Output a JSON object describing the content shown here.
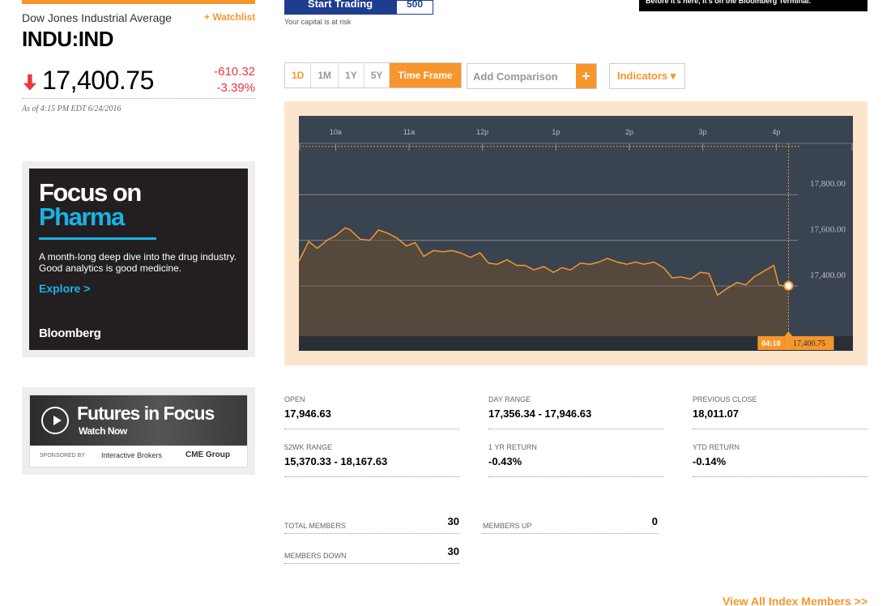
{
  "quote": {
    "index_name": "Dow Jones Industrial Average",
    "watchlist_label": "+ Watchlist",
    "ticker": "INDU:IND",
    "price": "17,400.75",
    "change_abs": "-610.32",
    "change_pct": "-3.39%",
    "as_of": "As of 4:15 PM EDT 6/24/2016",
    "direction_icon": "down-arrow-icon",
    "down_color": "#e8383d"
  },
  "ads": {
    "pharma": {
      "line1": "Focus on",
      "line2": "Pharma",
      "description": "A month-long deep dive into the drug industry. Good analytics is good medicine.",
      "cta": "Explore >",
      "brand": "Bloomberg"
    },
    "futures": {
      "title": "Futures in Focus",
      "watch": "Watch Now",
      "sponsored": "SPONSORED BY",
      "sponsor1": "Interactive Brokers",
      "sponsor2": "CME Group"
    }
  },
  "banner": {
    "start_trading": "Start Trading",
    "sp500": "500",
    "capital": "Your capital is at risk",
    "terminal": "Before it's here, it's on the Bloomberg Terminal."
  },
  "controls": {
    "timeframes": [
      "1D",
      "1M",
      "1Y",
      "5Y"
    ],
    "active_timeframe": "1D",
    "timeframe_button": "Time Frame",
    "comparison_placeholder": "Add Comparison",
    "add_icon": "plus-icon",
    "indicators": "Indicators ▾"
  },
  "chart_data": {
    "type": "area",
    "x_ticks": [
      "10a",
      "11a",
      "12p",
      "1p",
      "2p",
      "3p",
      "4p"
    ],
    "y_ticks": [
      "17,800.00",
      "17,600.00",
      "17,400.00"
    ],
    "y_tick_values": [
      17800,
      17600,
      17400
    ],
    "ylim": [
      17180,
      18010
    ],
    "previous_close_line": 18011.07,
    "cursor_time": "04:10",
    "cursor_value": "17,400.75",
    "x_range": [
      "09:30",
      "16:15"
    ],
    "series": [
      {
        "times": [
          "09:30",
          "09:38",
          "09:45",
          "09:53",
          "10:00",
          "10:08",
          "10:12",
          "10:20",
          "10:28",
          "10:35",
          "10:43",
          "10:50",
          "10:58",
          "11:05",
          "11:12",
          "11:20",
          "11:28",
          "11:35",
          "11:42",
          "11:50",
          "11:58",
          "12:05",
          "12:12",
          "12:20",
          "12:28",
          "12:35",
          "12:42",
          "12:50",
          "12:58",
          "13:05",
          "13:12",
          "13:20",
          "13:28",
          "13:35",
          "13:42",
          "13:50",
          "13:58",
          "14:05",
          "14:12",
          "14:20",
          "14:28",
          "14:35",
          "14:42",
          "14:50",
          "14:58",
          "15:05",
          "15:12",
          "15:20",
          "15:28",
          "15:35",
          "15:42",
          "15:50",
          "15:58",
          "16:02",
          "16:06",
          "16:10"
        ],
        "values": [
          17508,
          17595,
          17565,
          17600,
          17620,
          17655,
          17645,
          17605,
          17600,
          17645,
          17630,
          17610,
          17575,
          17590,
          17530,
          17555,
          17550,
          17555,
          17545,
          17525,
          17545,
          17500,
          17495,
          17515,
          17490,
          17490,
          17470,
          17485,
          17460,
          17480,
          17470,
          17500,
          17495,
          17505,
          17520,
          17505,
          17495,
          17505,
          17495,
          17505,
          17480,
          17435,
          17440,
          17430,
          17460,
          17455,
          17360,
          17390,
          17415,
          17405,
          17440,
          17465,
          17490,
          17405,
          17400,
          17400.75
        ],
        "color": "#f7962d"
      }
    ],
    "background": "#3a4350",
    "frame_color": "#fde4cc"
  },
  "stats": [
    {
      "label": "OPEN",
      "value": "17,946.63"
    },
    {
      "label": "DAY RANGE",
      "value": "17,356.34 - 17,946.63"
    },
    {
      "label": "PREVIOUS CLOSE",
      "value": "18,011.07"
    },
    {
      "label": "52WK RANGE",
      "value": "15,370.33 - 18,167.63"
    },
    {
      "label": "1 YR RETURN",
      "value": "-0.43%"
    },
    {
      "label": "YTD RETURN",
      "value": "-0.14%"
    }
  ],
  "members": {
    "total_label": "TOTAL MEMBERS",
    "total": "30",
    "up_label": "MEMBERS UP",
    "up": "0",
    "down_label": "MEMBERS DOWN",
    "down": "30"
  },
  "view_all": "View All Index Members  >>",
  "accent_color": "#f7962d"
}
